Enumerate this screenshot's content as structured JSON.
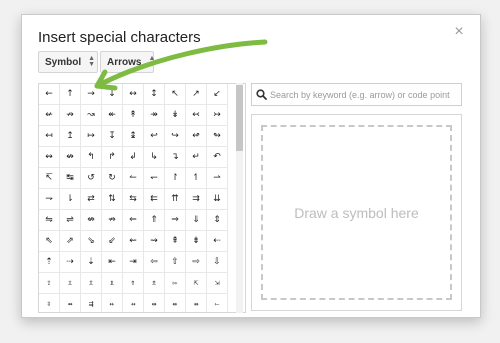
{
  "dialog": {
    "title": "Insert special characters",
    "close_label": "×"
  },
  "filters": {
    "category": "Symbol",
    "subcategory": "Arrows"
  },
  "search": {
    "placeholder": "Search by keyword (e.g. arrow) or code point"
  },
  "draw": {
    "prompt": "Draw a symbol here"
  },
  "symbols": [
    [
      "←",
      "↑",
      "→",
      "↓",
      "↔",
      "↕",
      "↖",
      "↗",
      "↙"
    ],
    [
      "↚",
      "↛",
      "↝",
      "↞",
      "↟",
      "↠",
      "↡",
      "↢",
      "↣"
    ],
    [
      "↤",
      "↥",
      "↦",
      "↧",
      "↨",
      "↩",
      "↪",
      "↫",
      "↬"
    ],
    [
      "↭",
      "↮",
      "↰",
      "↱",
      "↲",
      "↳",
      "↴",
      "↵",
      "↶"
    ],
    [
      "↸",
      "↹",
      "↺",
      "↻",
      "↼",
      "↽",
      "↾",
      "↿",
      "⇀"
    ],
    [
      "⇁",
      "⇂",
      "⇄",
      "⇅",
      "⇆",
      "⇇",
      "⇈",
      "⇉",
      "⇊"
    ],
    [
      "⇋",
      "⇌",
      "⇎",
      "⇏",
      "⇐",
      "⇑",
      "⇒",
      "⇓",
      "⇕"
    ],
    [
      "⇖",
      "⇗",
      "⇘",
      "⇙",
      "⇜",
      "⇝",
      "⇞",
      "⇟",
      "⇠"
    ],
    [
      "⇡",
      "⇢",
      "⇣",
      "⇤",
      "⇥",
      "⇦",
      "⇧",
      "⇨",
      "⇩"
    ],
    [
      "⇪",
      "⇫",
      "⇬",
      "⇭",
      "⇮",
      "⇯",
      "⇰",
      "⇱",
      "⇲"
    ],
    [
      "⇳",
      "⇴",
      "⇶",
      "⇷",
      "⇸",
      "⇹",
      "⇺",
      "⇻",
      "⇽"
    ],
    [
      "⇾",
      "⇿",
      "⇼",
      "⇺",
      "⇻",
      "⇽",
      "⇾",
      "⇿",
      "⇵"
    ]
  ],
  "colors": {
    "hint_arrow": "#7dbb42",
    "thumb": "#c6c6c6"
  }
}
